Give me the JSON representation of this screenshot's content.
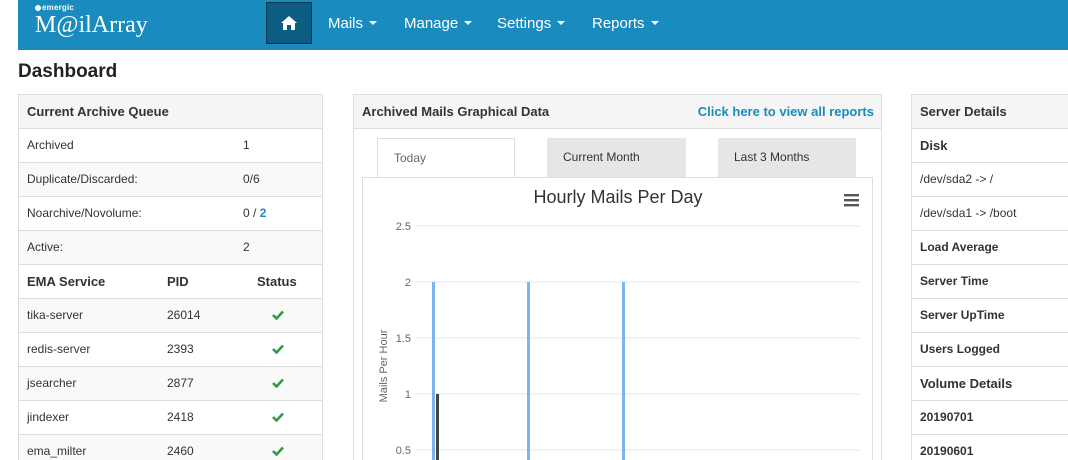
{
  "brand": {
    "small": "emergic",
    "name": "M@ilArray"
  },
  "nav": {
    "home_icon": "home-icon",
    "items": [
      {
        "label": "Mails"
      },
      {
        "label": "Manage"
      },
      {
        "label": "Settings"
      },
      {
        "label": "Reports"
      }
    ]
  },
  "page_title": "Dashboard",
  "archive_queue": {
    "title": "Current Archive Queue",
    "rows": [
      {
        "label": "Archived",
        "value": "1"
      },
      {
        "label": "Duplicate/Discarded:",
        "value": "0/6"
      },
      {
        "label": "Noarchive/Novolume:",
        "value_prefix": "0 / ",
        "value_link": "2"
      },
      {
        "label": "Active:",
        "value": "2"
      }
    ],
    "service_headers": {
      "service": "EMA Service",
      "pid": "PID",
      "status": "Status"
    },
    "services": [
      {
        "name": "tika-server",
        "pid": "26014",
        "status": "check-icon"
      },
      {
        "name": "redis-server",
        "pid": "2393",
        "status": "check-icon"
      },
      {
        "name": "jsearcher",
        "pid": "2877",
        "status": "check-icon"
      },
      {
        "name": "jindexer",
        "pid": "2418",
        "status": "check-icon"
      },
      {
        "name": "ema_milter",
        "pid": "2460",
        "status": "check-icon"
      }
    ]
  },
  "graph_panel": {
    "title": "Archived Mails Graphical Data",
    "link": "Click here to view all reports",
    "tabs": [
      {
        "label": "Today",
        "active": true
      },
      {
        "label": "Current Month",
        "active": false
      },
      {
        "label": "Last 3 Months",
        "active": false
      }
    ],
    "menu_icon": "hamburger-icon"
  },
  "chart_data": {
    "type": "bar",
    "title": "Hourly Mails Per Day",
    "ylabel": "Mails Per Hour",
    "ylim": [
      0,
      2.5
    ],
    "yticks": [
      "0.5",
      "1",
      "1.5",
      "2",
      "2.5"
    ],
    "grid": true,
    "series": [
      {
        "color": "#7cb5ec",
        "points": [
          {
            "x": 0,
            "y": 2
          },
          {
            "x": 1,
            "y": 2
          },
          {
            "x": 2,
            "y": 2
          }
        ]
      },
      {
        "color": "#434348",
        "points": [
          {
            "x": 0,
            "y": 1
          }
        ]
      }
    ]
  },
  "server_details": {
    "title": "Server Details",
    "rows": [
      {
        "text": "Disk",
        "style": "bold-big"
      },
      {
        "text": "/dev/sda2 -> /",
        "style": "normal"
      },
      {
        "text": "/dev/sda1 -> /boot",
        "style": "normal"
      },
      {
        "text": "Load Average",
        "style": "bold"
      },
      {
        "text": "Server Time",
        "style": "bold"
      },
      {
        "text": "Server UpTime",
        "style": "bold"
      },
      {
        "text": "Users Logged",
        "style": "bold"
      },
      {
        "text": "Volume Details",
        "style": "bold-big"
      },
      {
        "text": "20190701",
        "style": "bold"
      },
      {
        "text": "20190601",
        "style": "bold"
      }
    ]
  },
  "colors": {
    "navbar": "#1a8bbf",
    "home_active": "#0d5d82",
    "link": "#1a8bbf",
    "check": "#2e9e44"
  }
}
